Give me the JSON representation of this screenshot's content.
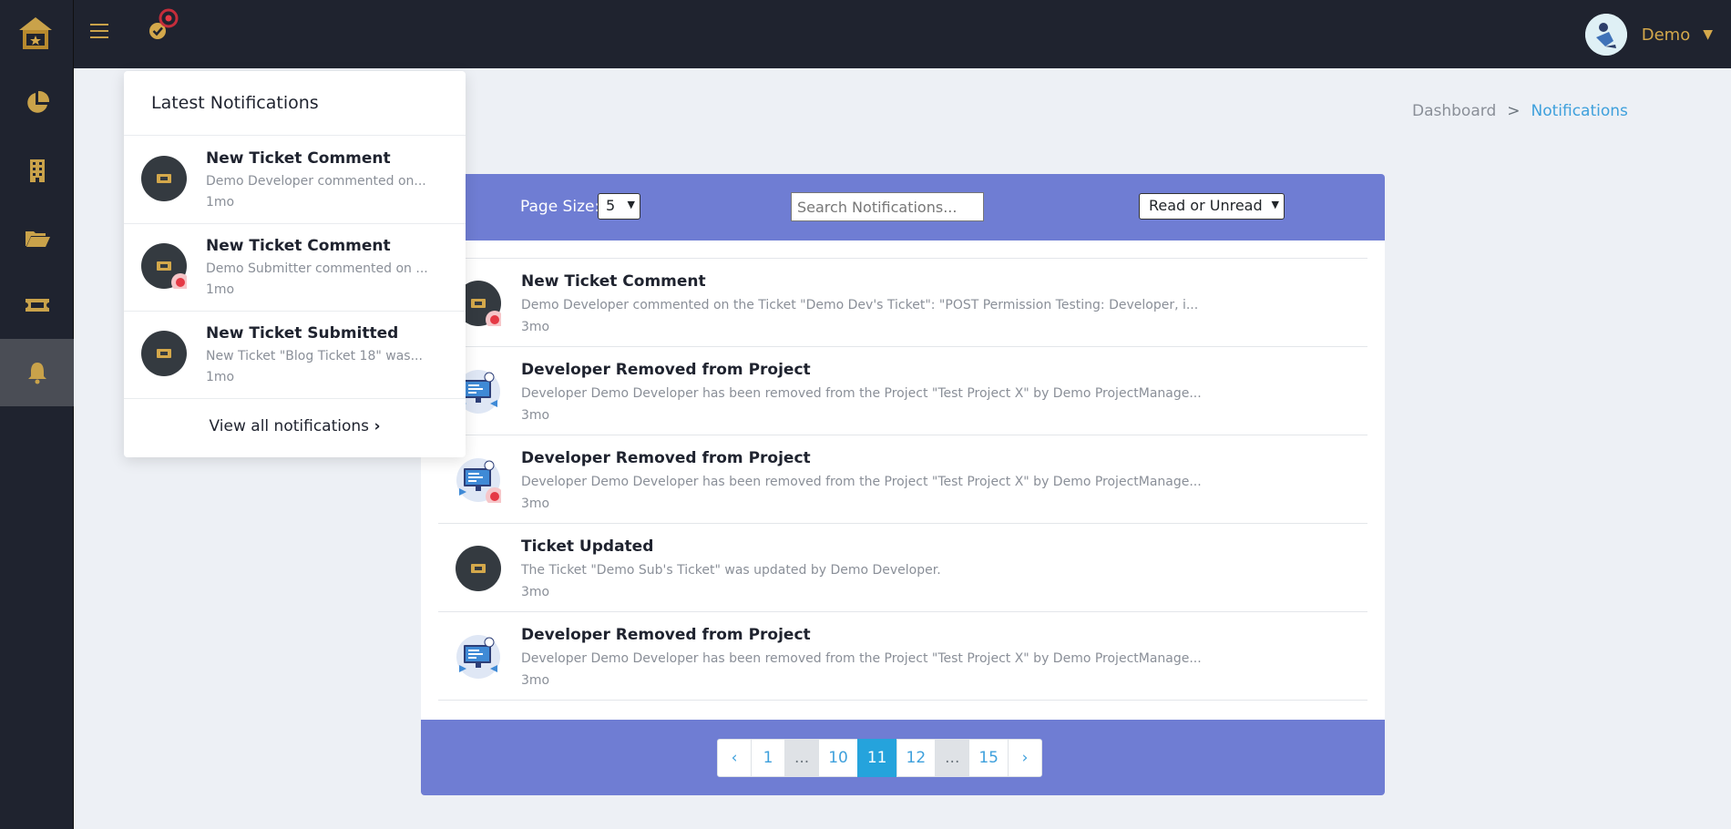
{
  "user": {
    "name": "Demo"
  },
  "breadcrumb": {
    "home": "Dashboard",
    "separator": ">",
    "current": "Notifications"
  },
  "controls": {
    "page_size_label": "Page Size:",
    "page_size_value": "5",
    "search_placeholder": "Search Notifications...",
    "read_filter_value": "Read or Unread"
  },
  "notifications": [
    {
      "title": "New Ticket Comment",
      "desc": "Demo Developer commented on the Ticket \"Demo Dev's Ticket\": \"POST Permission Testing: Developer, i...",
      "time": "3mo",
      "icon": "ticket-icon",
      "unread": true
    },
    {
      "title": "Developer Removed from Project",
      "desc": "Developer Demo Developer has been removed from the Project \"Test Project X\" by Demo ProjectManage...",
      "time": "3mo",
      "icon": "developer-computer-icon",
      "unread": false
    },
    {
      "title": "Developer Removed from Project",
      "desc": "Developer Demo Developer has been removed from the Project \"Test Project X\" by Demo ProjectManage...",
      "time": "3mo",
      "icon": "developer-computer-icon",
      "unread": true
    },
    {
      "title": "Ticket Updated",
      "desc": "The Ticket \"Demo Sub's Ticket\" was updated by Demo Developer.",
      "time": "3mo",
      "icon": "ticket-icon",
      "unread": false
    },
    {
      "title": "Developer Removed from Project",
      "desc": "Developer Demo Developer has been removed from the Project \"Test Project X\" by Demo ProjectManage...",
      "time": "3mo",
      "icon": "developer-computer-icon",
      "unread": false
    }
  ],
  "pagination": {
    "prev": "‹",
    "pages": [
      "1",
      "...",
      "10",
      "11",
      "12",
      "...",
      "15"
    ],
    "active": "11",
    "next": "›"
  },
  "dropdown": {
    "title": "Latest Notifications",
    "items": [
      {
        "title": "New Ticket Comment",
        "desc": "Demo Developer commented on...",
        "time": "1mo",
        "unread": false
      },
      {
        "title": "New Ticket Comment",
        "desc": "Demo Submitter commented on ...",
        "time": "1mo",
        "unread": true
      },
      {
        "title": "New Ticket Submitted",
        "desc": "New Ticket \"Blog Ticket 18\" was...",
        "time": "1mo",
        "unread": false
      }
    ],
    "footer": "View all notifications",
    "footer_chevron": "›"
  },
  "colors": {
    "sidebar": "#1f232f",
    "gold": "#d4a84b",
    "header_band": "#6f7dd3",
    "active_page": "#25a3dc",
    "link": "#3ea0dc",
    "unread_dot": "#e53945"
  }
}
